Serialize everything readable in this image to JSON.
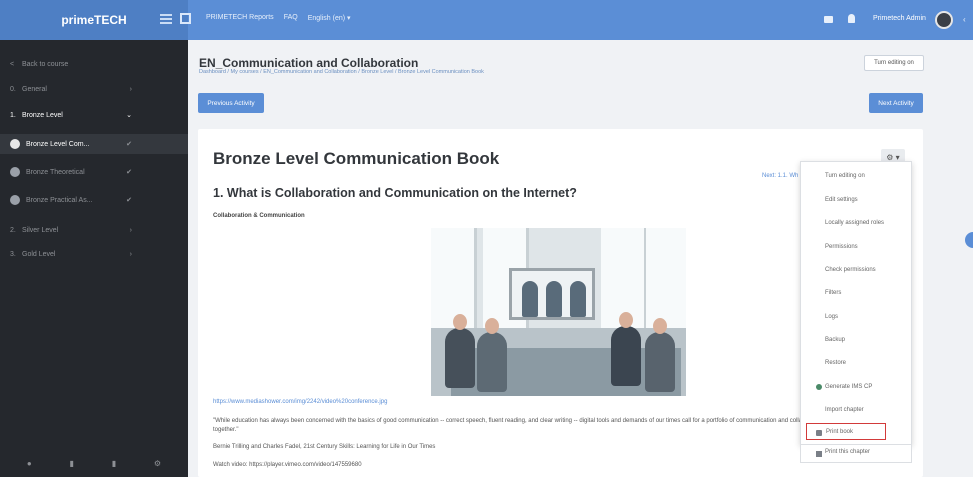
{
  "app": {
    "brand": "primeTECH"
  },
  "topnav": {
    "items": [
      "PRIMETECH Reports",
      "FAQ",
      "English (en) ▾"
    ],
    "user_name": "Primetech Admin",
    "icons": [
      "menu-icon",
      "fullscreen-icon",
      "message-icon",
      "bell-icon"
    ]
  },
  "sidebar": {
    "items": [
      {
        "num": "<",
        "label": "Back to course",
        "chev": ""
      },
      {
        "num": "0.",
        "label": "General",
        "chev": "›"
      },
      {
        "num": "1.",
        "label": "Bronze Level",
        "chev": "⌄"
      },
      {
        "num": "",
        "label": "Bronze Level Com...",
        "chev": "✔"
      },
      {
        "num": "",
        "label": "Bronze Theoretical",
        "chev": "✔"
      },
      {
        "num": "",
        "label": "Bronze Practical As...",
        "chev": "✔"
      },
      {
        "num": "2.",
        "label": "Silver Level",
        "chev": "›"
      },
      {
        "num": "3.",
        "label": "Gold Level",
        "chev": "›"
      }
    ]
  },
  "main": {
    "course_title": "EN_Communication and Collaboration",
    "breadcrumb": "Dashboard / My courses / EN_Communication and Collaboration / Bronze Level / Bronze Level Communication Book",
    "turn_editing": "Turn editing on",
    "prev_activity": "Previous Activity",
    "next_activity": "Next Activity",
    "book_title": "Bronze Level Communication Book",
    "chapter_title": "1. What is Collaboration and Communication on the Internet?",
    "next_link": "Next: 1.1. Wh",
    "subheading": "Collaboration & Communication",
    "url": "https://www.mediashower.com/img/2242/video%20conference.jpg",
    "quote": "\"While education has always been concerned with the basics of good communication -- correct speech, fluent reading, and clear writing -- digital tools and demands of our times call for a portfolio of communication and collaboration skills to promote learning together.\"",
    "attribution": "Bernie Trilling and Charles Fadel, 21st Century Skills: Learning for Life in Our Times",
    "watch": "Watch video: https://player.vimeo.com/video/147559680",
    "settings_icon": "⚙ ▾"
  },
  "menu": {
    "items": [
      "Turn editing on",
      "Edit settings",
      "Locally assigned roles",
      "Permissions",
      "Check permissions",
      "Filters",
      "Logs",
      "Backup",
      "Restore",
      "Generate IMS CP",
      "Import chapter",
      "Print book",
      "Print this chapter"
    ]
  }
}
